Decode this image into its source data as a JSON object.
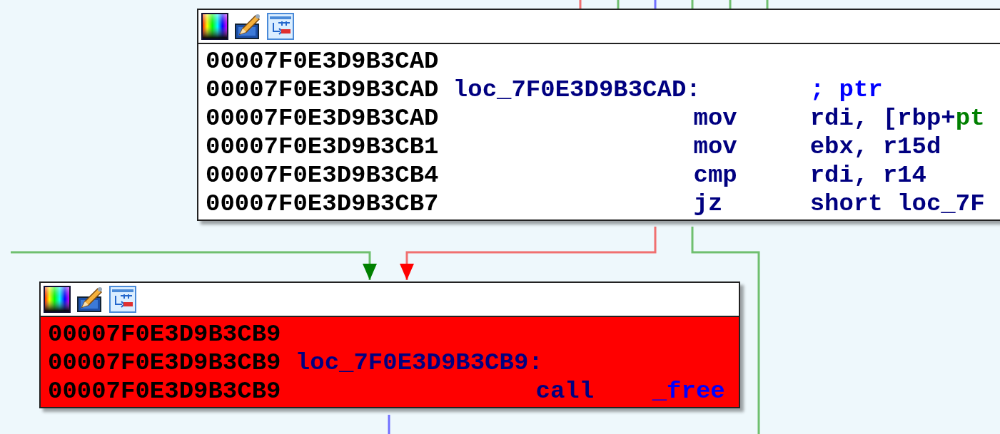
{
  "nodes": [
    {
      "color": "#ffffff",
      "lines": [
        {
          "address": "00007F0E3D9B3CAD"
        },
        {
          "address": "00007F0E3D9B3CAD",
          "label": "loc_7F0E3D9B3CAD:",
          "comment": "; ptr"
        },
        {
          "address": "00007F0E3D9B3CAD",
          "mnemonic": "mov",
          "operands": [
            {
              "text": "rdi, [rbp+",
              "kind": "plain"
            },
            {
              "text": "pt",
              "kind": "stackvar"
            }
          ]
        },
        {
          "address": "00007F0E3D9B3CB1",
          "mnemonic": "mov",
          "operands": [
            {
              "text": "ebx, r15d",
              "kind": "plain"
            }
          ]
        },
        {
          "address": "00007F0E3D9B3CB4",
          "mnemonic": "cmp",
          "operands": [
            {
              "text": "rdi, r14",
              "kind": "plain"
            }
          ]
        },
        {
          "address": "00007F0E3D9B3CB7",
          "mnemonic": "jz",
          "operands": [
            {
              "text": "short loc_7F",
              "kind": "plain"
            }
          ]
        }
      ]
    },
    {
      "color": "#ff0000",
      "lines": [
        {
          "address": "00007F0E3D9B3CB9"
        },
        {
          "address": "00007F0E3D9B3CB9",
          "label": "loc_7F0E3D9B3CB9:"
        },
        {
          "address": "00007F0E3D9B3CB9",
          "mnemonic": "call",
          "operands": [
            {
              "text": "_free",
              "kind": "function"
            }
          ]
        }
      ]
    }
  ],
  "edges": [
    {
      "kind": "false"
    },
    {
      "kind": "true"
    },
    {
      "kind": "normal"
    },
    {
      "kind": "true"
    },
    {
      "kind": "true"
    },
    {
      "kind": "true"
    },
    {
      "kind": "false"
    },
    {
      "kind": "true"
    },
    {
      "kind": "true"
    },
    {
      "kind": "normal"
    }
  ]
}
